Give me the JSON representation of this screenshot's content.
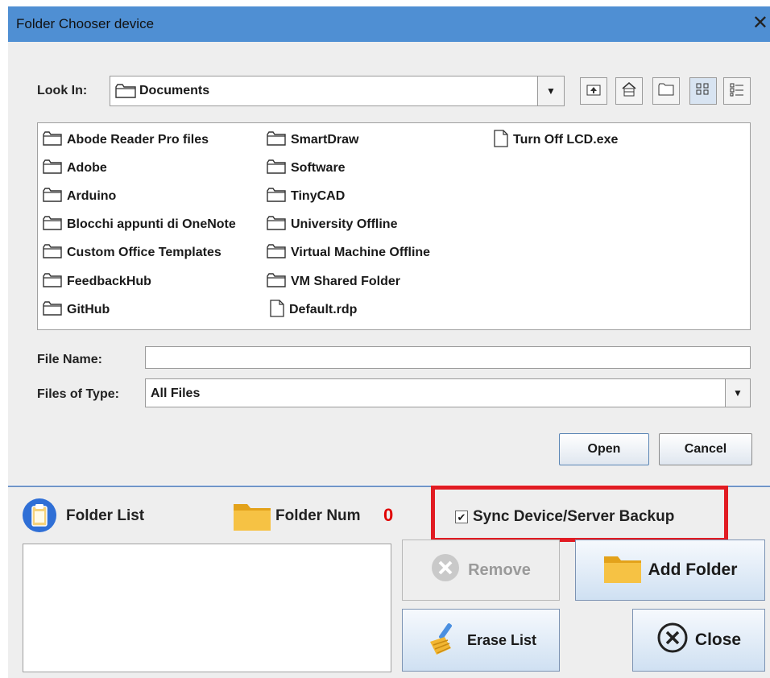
{
  "window": {
    "title": "Folder Chooser device",
    "close_glyph": "✕"
  },
  "chooser": {
    "look_in_label": "Look In:",
    "look_in_value": "Documents",
    "toolbar_icons": [
      "up-one-level-icon",
      "home-icon",
      "new-folder-icon",
      "list-view-icon",
      "details-view-icon"
    ],
    "files": [
      {
        "name": "Abode Reader Pro files",
        "type": "folder"
      },
      {
        "name": "Adobe",
        "type": "folder"
      },
      {
        "name": "Arduino",
        "type": "folder"
      },
      {
        "name": "Blocchi appunti di OneNote",
        "type": "folder"
      },
      {
        "name": "Custom Office Templates",
        "type": "folder"
      },
      {
        "name": "FeedbackHub",
        "type": "folder"
      },
      {
        "name": "GitHub",
        "type": "folder"
      },
      {
        "name": "SmartDraw",
        "type": "folder"
      },
      {
        "name": "Software",
        "type": "folder"
      },
      {
        "name": "TinyCAD",
        "type": "folder"
      },
      {
        "name": "University Offline",
        "type": "folder"
      },
      {
        "name": "Virtual Machine Offline",
        "type": "folder"
      },
      {
        "name": "VM Shared Folder",
        "type": "folder"
      },
      {
        "name": "Default.rdp",
        "type": "file"
      },
      {
        "name": "Turn Off LCD.exe",
        "type": "file"
      }
    ],
    "file_name_label": "File Name:",
    "file_name_value": "",
    "files_of_type_label": "Files of Type:",
    "files_of_type_value": "All Files",
    "open_label": "Open",
    "cancel_label": "Cancel"
  },
  "panel": {
    "folder_list_label": "Folder List",
    "folder_num_label": "Folder Num",
    "folder_num_value": "0",
    "sync_label": "Sync Device/Server Backup",
    "sync_checked": true,
    "highlight_color": "#e11b22",
    "remove_label": "Remove",
    "add_folder_label": "Add Folder",
    "erase_list_label": "Erase List",
    "close_label": "Close"
  }
}
